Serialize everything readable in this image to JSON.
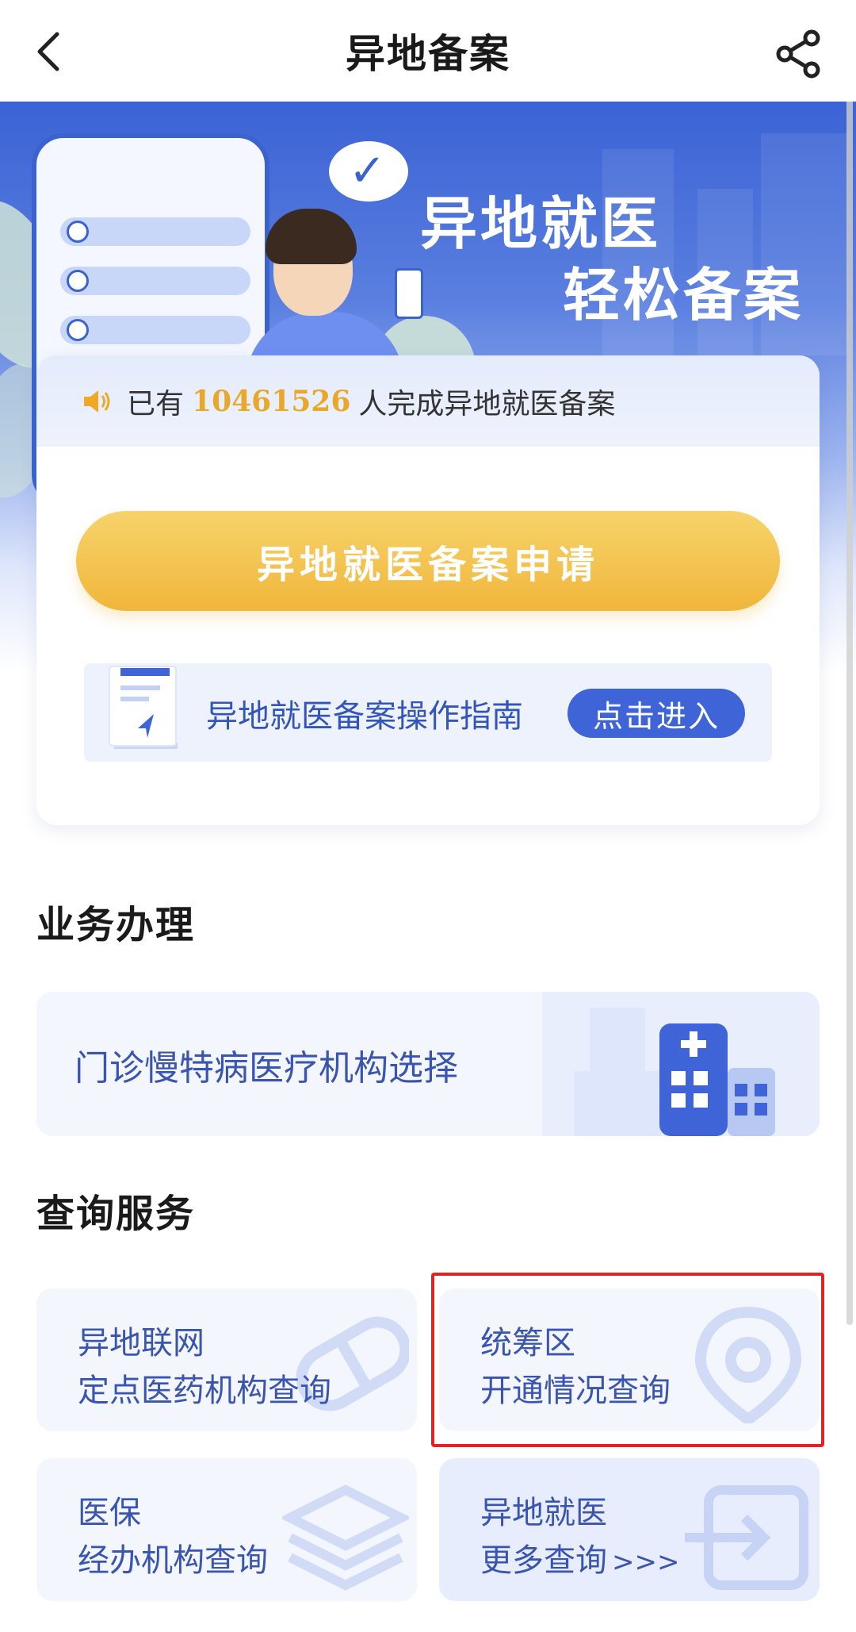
{
  "header": {
    "title": "异地备案"
  },
  "banner": {
    "slogan_line1": "异地就医",
    "slogan_line2": "轻松备案"
  },
  "notice": {
    "prefix": "已有",
    "count": "10461526",
    "suffix": "人完成异地就医备案"
  },
  "apply_button": {
    "label": "异地就医备案申请"
  },
  "guide": {
    "label": "异地就医备案操作指南",
    "button": "点击进入"
  },
  "business": {
    "title": "业务办理",
    "items": [
      {
        "label": "门诊慢特病医疗机构选择"
      }
    ]
  },
  "query": {
    "title": "查询服务",
    "items": [
      {
        "line1": "异地联网",
        "line2": "定点医药机构查询",
        "icon": "pill-icon"
      },
      {
        "line1": "统筹区",
        "line2": "开通情况查询",
        "icon": "location-pin-icon"
      },
      {
        "line1": "医保",
        "line2": "经办机构查询",
        "icon": "layers-icon"
      },
      {
        "line1": "异地就医",
        "line2": "更多查询",
        "arrows": ">>>",
        "icon": "enter-icon"
      }
    ]
  },
  "colors": {
    "primary": "#3e64d8",
    "accent": "#f0b63b",
    "highlight": "#e32222"
  }
}
